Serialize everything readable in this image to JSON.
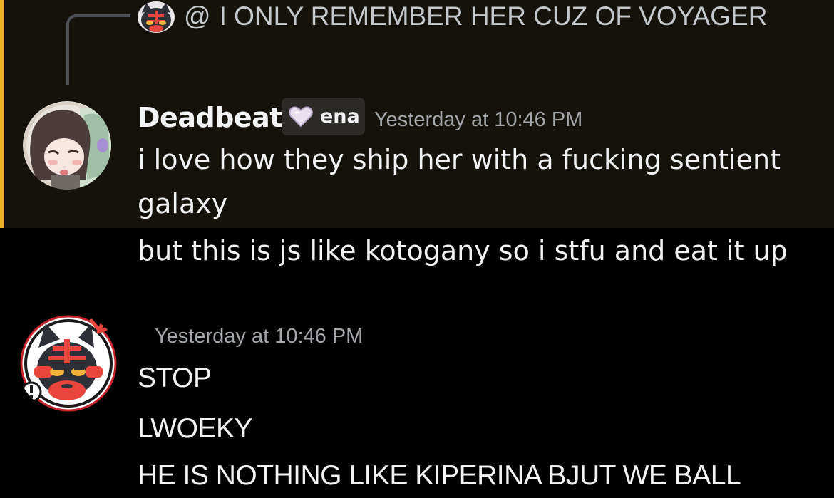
{
  "reply_preview": {
    "at_symbol": "@",
    "text": "I ONLY REMEMBER HER CUZ OF VOYAGER"
  },
  "message_deadbeat": {
    "username": "Deadbeat",
    "tag": "ena",
    "timestamp": "Yesterday at 10:46 PM",
    "lines": [
      "i love how they ship her with a fucking sentient",
      "galaxy",
      "but this is js like kotogany so i stfu and eat it up"
    ]
  },
  "message_cat": {
    "timestamp": "Yesterday at 10:46 PM",
    "lines": [
      "STOP",
      "LWOEKY",
      "HE IS NOTHING LIKE KIPERINA BJUT WE BALL"
    ]
  },
  "colors": {
    "background": "#000000",
    "mention_highlight": "#15120b",
    "mention_bar": "#f0b232",
    "username": "#f2f3f5",
    "timestamp": "#a3a6aa",
    "message_text": "#f2f3f5"
  },
  "icons": {
    "reply_avatar": "cat-avatar-icon",
    "deadbeat_avatar": "anime-avatar-icon",
    "cat_avatar": "cat-avatar-icon",
    "tag_icon": "heart-icon"
  }
}
